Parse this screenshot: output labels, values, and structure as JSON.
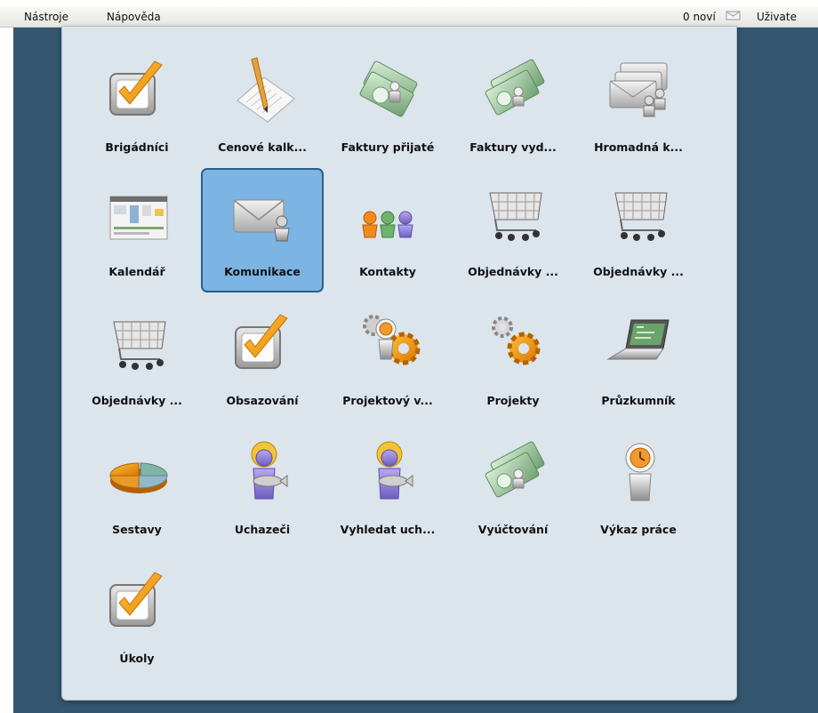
{
  "menubar": {
    "tools": "Nástroje",
    "help": "Nápověda",
    "new_messages": "0  noví",
    "user": "Uživate"
  },
  "launcher": {
    "selected": "Komunikace",
    "items": [
      {
        "label": "Brigádníci",
        "icon": "checkbox-check-icon"
      },
      {
        "label": "Cenové kalk...",
        "icon": "document-pen-icon"
      },
      {
        "label": "Faktury přijaté",
        "icon": "money-bills-person-icon"
      },
      {
        "label": "Faktury vyd...",
        "icon": "money-bills-icon"
      },
      {
        "label": "Hromadná k...",
        "icon": "envelopes-people-icon"
      },
      {
        "label": "Kalendář",
        "icon": "calendar-screenshot-icon"
      },
      {
        "label": "Komunikace",
        "icon": "envelope-person-icon"
      },
      {
        "label": "Kontakty",
        "icon": "people-group-icon"
      },
      {
        "label": "Objednávky ...",
        "icon": "shopping-cart-icon"
      },
      {
        "label": "Objednávky ...",
        "icon": "shopping-cart-icon"
      },
      {
        "label": "Objednávky ...",
        "icon": "shopping-cart-icon"
      },
      {
        "label": "Obsazování",
        "icon": "checkbox-check-icon"
      },
      {
        "label": "Projektový v...",
        "icon": "gears-clock-person-icon"
      },
      {
        "label": "Projekty",
        "icon": "gears-icon"
      },
      {
        "label": "Průzkumník",
        "icon": "laptop-icon"
      },
      {
        "label": "Sestavy",
        "icon": "pie-chart-icon"
      },
      {
        "label": "Uchazeči",
        "icon": "person-with-fish-icon"
      },
      {
        "label": "Vyhledat uch...",
        "icon": "person-with-fish-icon"
      },
      {
        "label": "Vyúčtování",
        "icon": "money-bills-icon"
      },
      {
        "label": "Výkaz práce",
        "icon": "clock-person-icon"
      },
      {
        "label": "Úkoly",
        "icon": "checkbox-check-icon"
      }
    ]
  }
}
